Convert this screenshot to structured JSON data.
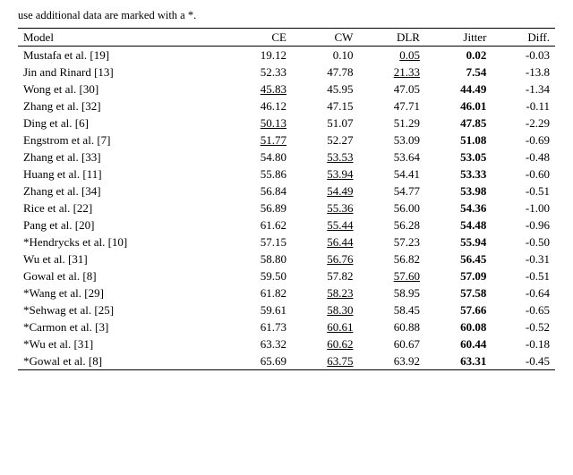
{
  "note": "use additional data are marked with a *.",
  "table": {
    "headers": [
      "Model",
      "CE",
      "CW",
      "DLR",
      "Jitter",
      "Diff."
    ],
    "rows": [
      {
        "model": "Mustafa et al. [19]",
        "star": false,
        "ce": "19.12",
        "cw": "0.10",
        "dlr": "0.05",
        "dlr_underline": true,
        "jitter": "0.02",
        "jitter_bold": true,
        "diff": "-0.03"
      },
      {
        "model": "Jin and Rinard [13]",
        "star": false,
        "ce": "52.33",
        "cw": "47.78",
        "dlr": "21.33",
        "dlr_underline": true,
        "jitter": "7.54",
        "jitter_bold": true,
        "diff": "-13.8"
      },
      {
        "model": "Wong et al. [30]",
        "star": false,
        "ce": "45.83",
        "ce_underline": true,
        "cw": "45.95",
        "dlr": "47.05",
        "dlr_underline": false,
        "jitter": "44.49",
        "jitter_bold": true,
        "diff": "-1.34"
      },
      {
        "model": "Zhang et al. [32]",
        "star": false,
        "ce": "46.12",
        "cw": "47.15",
        "dlr": "47.71",
        "jitter": "46.01",
        "jitter_bold": true,
        "diff": "-0.11"
      },
      {
        "model": "Ding et al. [6]",
        "star": false,
        "ce": "50.13",
        "ce_underline": true,
        "cw": "51.07",
        "dlr": "51.29",
        "jitter": "47.85",
        "jitter_bold": true,
        "diff": "-2.29"
      },
      {
        "model": "Engstrom et al. [7]",
        "star": false,
        "ce": "51.77",
        "ce_underline": true,
        "cw": "52.27",
        "dlr": "53.09",
        "jitter": "51.08",
        "jitter_bold": true,
        "diff": "-0.69"
      },
      {
        "model": "Zhang et al. [33]",
        "star": false,
        "ce": "54.80",
        "cw": "53.53",
        "cw_underline": true,
        "dlr": "53.64",
        "jitter": "53.05",
        "jitter_bold": true,
        "diff": "-0.48"
      },
      {
        "model": "Huang et al. [11]",
        "star": false,
        "ce": "55.86",
        "cw": "53.94",
        "cw_underline": true,
        "dlr": "54.41",
        "jitter": "53.33",
        "jitter_bold": true,
        "diff": "-0.60"
      },
      {
        "model": "Zhang et al. [34]",
        "star": false,
        "ce": "56.84",
        "cw": "54.49",
        "cw_underline": true,
        "dlr": "54.77",
        "jitter": "53.98",
        "jitter_bold": true,
        "diff": "-0.51"
      },
      {
        "model": "Rice et al. [22]",
        "star": false,
        "ce": "56.89",
        "cw": "55.36",
        "cw_underline": true,
        "dlr": "56.00",
        "jitter": "54.36",
        "jitter_bold": true,
        "diff": "-1.00"
      },
      {
        "model": "Pang et al. [20]",
        "star": false,
        "ce": "61.62",
        "cw": "55.44",
        "cw_underline": true,
        "dlr": "56.28",
        "jitter": "54.48",
        "jitter_bold": true,
        "diff": "-0.96"
      },
      {
        "model": "Hendrycks et al. [10]",
        "star": true,
        "ce": "57.15",
        "cw": "56.44",
        "cw_underline": true,
        "dlr": "57.23",
        "jitter": "55.94",
        "jitter_bold": true,
        "diff": "-0.50"
      },
      {
        "model": "Wu et al. [31]",
        "star": false,
        "ce": "58.80",
        "cw": "56.76",
        "cw_underline": true,
        "dlr": "56.82",
        "jitter": "56.45",
        "jitter_bold": true,
        "diff": "-0.31"
      },
      {
        "model": "Gowal et al. [8]",
        "star": false,
        "ce": "59.50",
        "cw": "57.82",
        "dlr": "57.60",
        "dlr_underline": true,
        "jitter": "57.09",
        "jitter_bold": true,
        "diff": "-0.51"
      },
      {
        "model": "Wang et al. [29]",
        "star": true,
        "ce": "61.82",
        "cw": "58.23",
        "cw_underline": true,
        "dlr": "58.95",
        "jitter": "57.58",
        "jitter_bold": true,
        "diff": "-0.64"
      },
      {
        "model": "Sehwag et al. [25]",
        "star": true,
        "ce": "59.61",
        "cw": "58.30",
        "cw_underline": true,
        "dlr": "58.45",
        "jitter": "57.66",
        "jitter_bold": true,
        "diff": "-0.65"
      },
      {
        "model": "Carmon et al. [3]",
        "star": true,
        "ce": "61.73",
        "cw": "60.61",
        "cw_underline": true,
        "dlr": "60.88",
        "jitter": "60.08",
        "jitter_bold": true,
        "diff": "-0.52"
      },
      {
        "model": "Wu et al. [31]",
        "star": true,
        "ce": "63.32",
        "cw": "60.62",
        "cw_underline": true,
        "dlr": "60.67",
        "jitter": "60.44",
        "jitter_bold": true,
        "diff": "-0.18"
      },
      {
        "model": "Gowal et al. [8]",
        "star": true,
        "ce": "65.69",
        "cw": "63.75",
        "cw_underline": true,
        "dlr": "63.92",
        "jitter": "63.31",
        "jitter_bold": true,
        "diff": "-0.45"
      }
    ]
  }
}
